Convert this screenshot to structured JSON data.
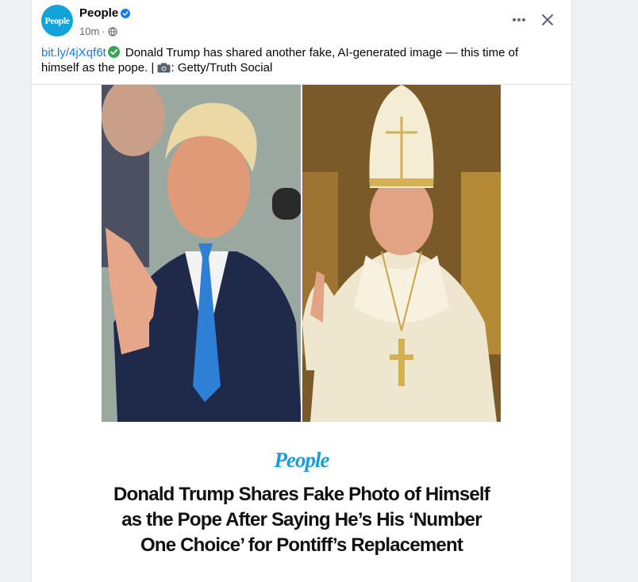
{
  "post": {
    "page_name": "People",
    "avatar_text": "People",
    "time": "10m",
    "time_separator": "·",
    "caption_link": "bit.ly/4jXqf6t",
    "caption_text": " Donald Trump has shared another fake, AI-generated image — this time of himself as the pope. | ",
    "caption_credit": ": Getty/Truth Social"
  },
  "article": {
    "brand": "People",
    "headline": "Donald Trump Shares Fake Photo of Himself as the Pope After Saying He’s His ‘Number One Choice’ for Pontiff’s Replacement"
  },
  "icons": {
    "verified": "verified-badge-icon",
    "globe": "globe-icon",
    "more": "more-options-icon",
    "close": "close-icon",
    "check": "check-mark-icon",
    "camera": "camera-icon"
  },
  "colors": {
    "link": "#1877f2",
    "brand": "#14a0d6",
    "verified": "#1877f2",
    "check": "#35a550"
  }
}
